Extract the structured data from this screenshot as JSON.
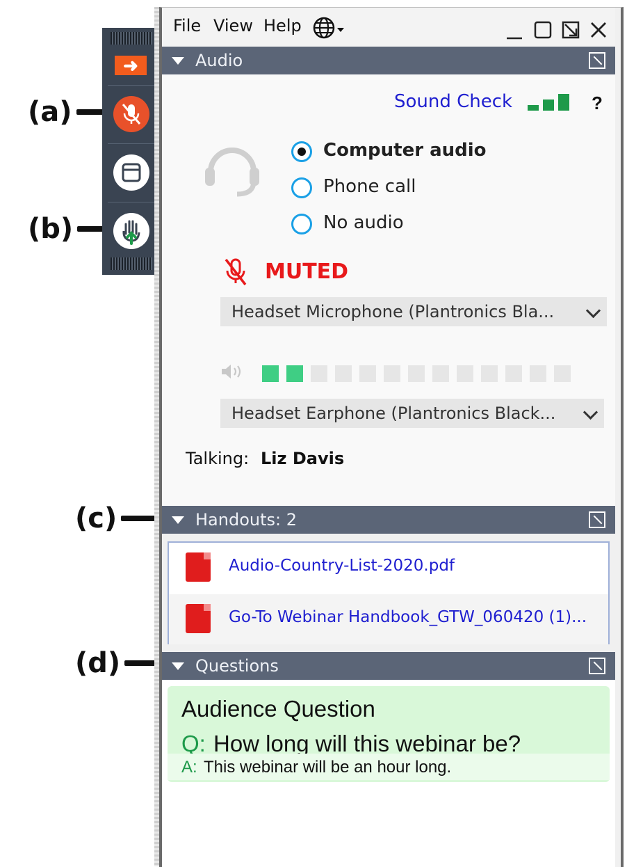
{
  "annotations": [
    "(a)",
    "(b)",
    "(c)",
    "(d)"
  ],
  "toolbar": {
    "buttons": [
      {
        "icon": "arrow-right-icon"
      },
      {
        "icon": "muted-microphone-icon",
        "color": "#e8512a"
      },
      {
        "icon": "window-icon"
      },
      {
        "icon": "raise-hand-icon",
        "color": "#1e9a4a"
      }
    ]
  },
  "menubar": {
    "items": [
      "File",
      "View",
      "Help"
    ],
    "language_icon": "globe-icon",
    "window_controls": [
      "minimize-icon",
      "maximize-icon",
      "popout-icon",
      "close-icon"
    ]
  },
  "audio": {
    "title": "Audio",
    "sound_check": "Sound Check",
    "help": "?",
    "options": [
      {
        "label": "Computer audio",
        "selected": true
      },
      {
        "label": "Phone call",
        "selected": false
      },
      {
        "label": "No audio",
        "selected": false
      }
    ],
    "mute_status": "MUTED",
    "microphone": "Headset Microphone (Plantronics Bla...",
    "speaker_level": {
      "active": 2,
      "total": 13
    },
    "speaker": "Headset Earphone (Plantronics Black...",
    "talking_label": "Talking:",
    "talking_name": "Liz Davis"
  },
  "handouts": {
    "title": "Handouts: 2",
    "files": [
      "Audio-Country-List-2020.pdf",
      "Go-To Webinar Handbook_GTW_060420 (1)..."
    ]
  },
  "questions": {
    "title": "Questions",
    "heading": "Audience Question",
    "q_prefix": "Q:",
    "question": "How long will this webinar be?",
    "a_prefix": "A:",
    "answer": "This webinar will be an hour long."
  },
  "colors": {
    "panel_header": "#5b6577",
    "muted_red": "#e8191b",
    "link_blue": "#1f1fd0",
    "level_green": "#3fce84",
    "radio_blue": "#1aa0e6"
  }
}
